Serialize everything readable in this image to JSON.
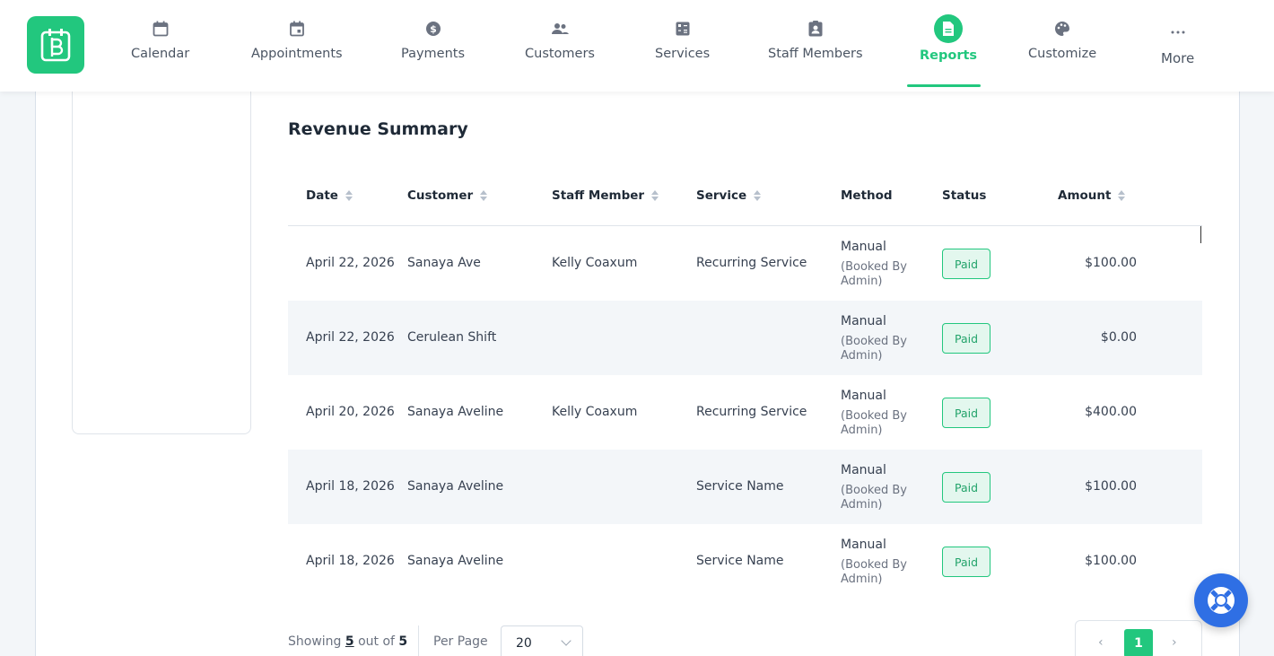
{
  "nav": {
    "items": [
      {
        "label": "Calendar",
        "icon": "calendar-icon"
      },
      {
        "label": "Appointments",
        "icon": "calendar-check-icon"
      },
      {
        "label": "Payments",
        "icon": "dollar-icon"
      },
      {
        "label": "Customers",
        "icon": "users-icon"
      },
      {
        "label": "Services",
        "icon": "calculator-icon"
      },
      {
        "label": "Staff Members",
        "icon": "id-badge-icon"
      },
      {
        "label": "Reports",
        "icon": "report-icon"
      },
      {
        "label": "Customize",
        "icon": "palette-icon"
      },
      {
        "label": "More",
        "icon": "dots-icon"
      }
    ],
    "active": "Reports",
    "accent": "#22c77e"
  },
  "report": {
    "title": "Revenue Summary",
    "columns": [
      "Date",
      "Customer",
      "Staff Member",
      "Service",
      "Method",
      "Status",
      "Amount"
    ],
    "rows": [
      {
        "date": "April 22, 2026",
        "customer": "Sanaya Ave",
        "staff": "Kelly Coaxum",
        "service": "Recurring Service",
        "method": "Manual",
        "method_note": "(Booked By Admin)",
        "status": "Paid",
        "amount": "$100.00"
      },
      {
        "date": "April 22, 2026",
        "customer": "Cerulean Shift",
        "staff": "",
        "service": "",
        "method": "Manual",
        "method_note": "(Booked By Admin)",
        "status": "Paid",
        "amount": "$0.00"
      },
      {
        "date": "April 20, 2026",
        "customer": "Sanaya Aveline",
        "staff": "Kelly Coaxum",
        "service": "Recurring Service",
        "method": "Manual",
        "method_note": "(Booked By Admin)",
        "status": "Paid",
        "amount": "$400.00"
      },
      {
        "date": "April 18, 2026",
        "customer": "Sanaya Aveline",
        "staff": "",
        "service": "Service Name",
        "method": "Manual",
        "method_note": "(Booked By Admin)",
        "status": "Paid",
        "amount": "$100.00"
      },
      {
        "date": "April 18, 2026",
        "customer": "Sanaya Aveline",
        "staff": "",
        "service": "Service Name",
        "method": "Manual",
        "method_note": "(Booked By Admin)",
        "status": "Paid",
        "amount": "$100.00"
      }
    ]
  },
  "footer": {
    "showing_prefix": "Showing",
    "showing_count": "5",
    "showing_mid": "out of",
    "showing_total": "5",
    "per_page_label": "Per Page",
    "per_page_value": "20",
    "page_prev": "‹",
    "page_current": "1",
    "page_next": "›"
  }
}
